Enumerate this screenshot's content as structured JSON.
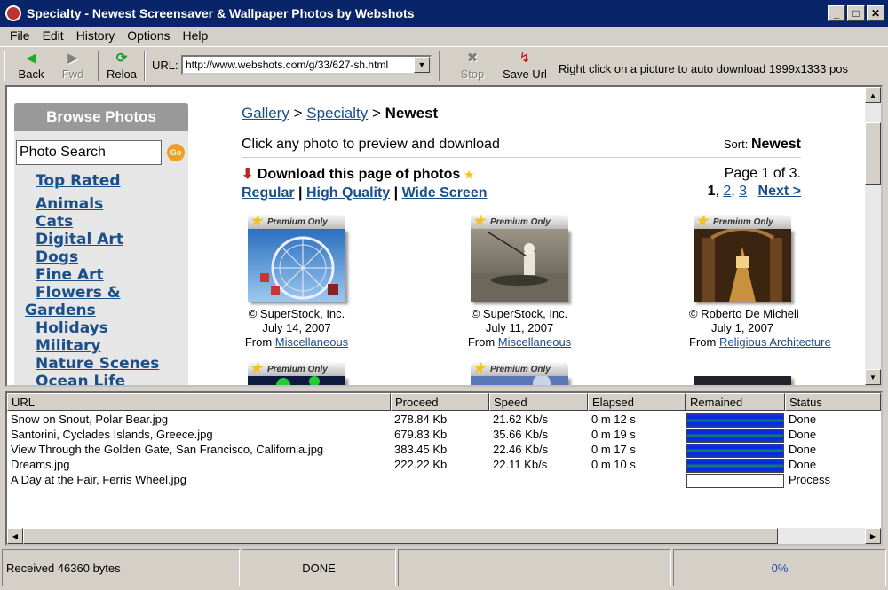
{
  "window": {
    "title": "Specialty - Newest Screensaver & Wallpaper Photos by Webshots",
    "minimize": "_",
    "maximize": "□",
    "close": "✕"
  },
  "menu": [
    "File",
    "Edit",
    "History",
    "Options",
    "Help"
  ],
  "toolbar": {
    "back": "Back",
    "fwd": "Fwd",
    "reload": "Reloa",
    "url_label": "URL:",
    "url_value": "http://www.webshots.com/g/33/627-sh.html",
    "stop": "Stop",
    "save_url": "Save Url",
    "hint": "Right click on a picture to auto download 1999x1333 pos"
  },
  "sidebar": {
    "heading": "Browse Photos",
    "search_placeholder": "Photo Search",
    "go": "Go",
    "top_rated": "Top Rated",
    "categories": [
      "Animals",
      "Cats",
      "Digital Art",
      "Dogs",
      "Fine Art",
      "Flowers &",
      "Gardens",
      "Holidays",
      "Military",
      "Nature Scenes",
      "Ocean Life"
    ]
  },
  "main": {
    "breadcrumb": {
      "gallery": "Gallery",
      "sep": ">",
      "specialty": "Specialty",
      "current": "Newest"
    },
    "intro": "Click any photo to preview and download",
    "sort_label": "Sort:",
    "sort_value": "Newest",
    "download_title": "Download this page of photos",
    "quality": {
      "regular": "Regular",
      "high": "High Quality",
      "wide": "Wide Screen",
      "sep": "|"
    },
    "page_info": "Page 1 of 3.",
    "pages": [
      "1",
      "2",
      "3"
    ],
    "next": "Next >",
    "premium_label": "Premium Only",
    "from_label": "From",
    "photos": [
      {
        "credit": "© SuperStock, Inc.",
        "date": "July 14, 2007",
        "category": "Miscellaneous"
      },
      {
        "credit": "© SuperStock, Inc.",
        "date": "July 11, 2007",
        "category": "Miscellaneous"
      },
      {
        "credit": "© Roberto De Micheli",
        "date": "July 1, 2007",
        "category": "Religious Architecture"
      }
    ]
  },
  "downloads": {
    "columns": [
      "URL",
      "Proceed",
      "Speed",
      "Elapsed",
      "Remained",
      "Status"
    ],
    "rows": [
      {
        "url": "Snow on Snout, Polar Bear.jpg",
        "proceed": "278.84 Kb",
        "speed": "21.62 Kb/s",
        "elapsed": "0 m 12 s",
        "remained_pct": 100,
        "status": "Done"
      },
      {
        "url": "Santorini, Cyclades Islands, Greece.jpg",
        "proceed": "679.83 Kb",
        "speed": "35.66 Kb/s",
        "elapsed": "0 m 19 s",
        "remained_pct": 100,
        "status": "Done"
      },
      {
        "url": "View Through the Golden Gate, San Francisco, California.jpg",
        "proceed": "383.45 Kb",
        "speed": "22.46 Kb/s",
        "elapsed": "0 m 17 s",
        "remained_pct": 100,
        "status": "Done"
      },
      {
        "url": "Dreams.jpg",
        "proceed": "222.22 Kb",
        "speed": "22.11 Kb/s",
        "elapsed": "0 m 10 s",
        "remained_pct": 100,
        "status": "Done"
      },
      {
        "url": "A Day at the Fair, Ferris Wheel.jpg",
        "proceed": "",
        "speed": "",
        "elapsed": "",
        "remained_pct": 0,
        "status": "Process"
      }
    ]
  },
  "status": {
    "received": "Received 46360 bytes",
    "state": "DONE",
    "percent": "0%"
  },
  "colors": {
    "title_bar": "#0a246a",
    "link": "#1a4f8a",
    "progress": "#0022ff"
  }
}
